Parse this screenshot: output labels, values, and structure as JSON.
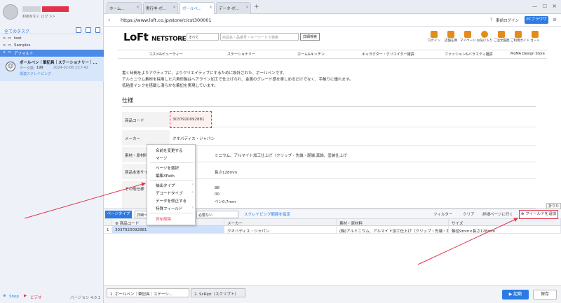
{
  "sidebar": {
    "user_sub": "利用を引く ログ >>",
    "all_tasks": "全てのタスク",
    "tree": [
      {
        "label": "test",
        "arrow": ">"
      },
      {
        "label": "Samples",
        "arrow": ">"
      },
      {
        "label": "デフォルト",
        "arrow": "∨"
      }
    ],
    "task": {
      "name": "ボールペン｜筆記具｜ステーショナリー｜...",
      "count_label": "データ数:",
      "count": "199",
      "date": "2024-02-08 13:7:42",
      "link": "関連スクレイピング"
    },
    "footer": {
      "shop": "Shop",
      "video": "ビデオ",
      "version": "バージョン 4.0.1"
    }
  },
  "browser": {
    "tabs": [
      {
        "label": "ホーム..."
      },
      {
        "label": "実行中-ボ..."
      },
      {
        "label": "ボールペ..."
      },
      {
        "label": "データ-ボ..."
      }
    ],
    "url": "https://www.loft.co.jp/store/c/cst300001",
    "login": "事前ログイン",
    "pc_browser": "PCブラウザ"
  },
  "site": {
    "logo_big": "LoFt",
    "logo_small": "NETSTORE",
    "select": "すべて",
    "search_placeholder": "商品名・品番号・キーワードで検索",
    "detail_search": "詳細検索",
    "header_icons": [
      {
        "label": "ログイン",
        "name": "login-icon"
      },
      {
        "label": "店舗在庫",
        "name": "store-icon"
      },
      {
        "label": "マイページ",
        "name": "mypage-icon"
      },
      {
        "label": "お気に入り",
        "name": "favorite-icon"
      },
      {
        "label": "ご注文履歴",
        "name": "order-history-icon"
      },
      {
        "label": "ご利用ガイド",
        "name": "guide-icon"
      },
      {
        "label": "カート",
        "name": "cart-icon"
      }
    ],
    "categories": [
      "コスメ&ビューティー",
      "ステーショナリー",
      "ホーム&キッチン",
      "キャラクター・クリエイター雑貨",
      "ファッション&バラエティ雑貨",
      "MoMA Design Store"
    ],
    "paragraph": [
      "書く時間をよりアクティブに、よりクリエイティブにするために設計された、ボールペンです。",
      "アルミニウム素材を採用した六角形軸はヘアライン加工で仕上げられ、金属のグレード感を楽しめるだけでなく、手触りに優れます。",
      "低粘度インクを搭載し滑らかな筆記を実現しています。"
    ],
    "spec_heading": "仕様",
    "spec_rows": [
      {
        "label": "商品コード",
        "value": "3037920092881"
      },
      {
        "label": "メーカー",
        "value": "クオバディス・ジャパン"
      },
      {
        "label": "素材・原材料",
        "value": "ミニウム、アルマイト加工仕上げ（クリップ・先端・尾端:真鍮、塗装仕上げ"
      },
      {
        "label": "商品本体サイズ",
        "value": "長さ128mm"
      },
      {
        "label": "その他仕様",
        "value": "88"
      },
      {
        "label": "",
        "value": "00"
      },
      {
        "label": "",
        "value": "ペン0.7mm"
      }
    ]
  },
  "context_menu": [
    "名前を変更する",
    "マージ",
    "ページを選択",
    "編集XPath",
    "抽出タイプ",
    "デコードタイプ",
    "データを修正する",
    "特殊フィールド",
    "列を削除"
  ],
  "toolbar": {
    "page_type": "ページタイプ",
    "dropdown": "詳細ページ",
    "not_needed": "必要ない",
    "scrape_range": "スクレイピング範囲を指定",
    "filter": "フィルター",
    "clear": "クリア",
    "goto_detail": "詳細ページに行く",
    "add_field": "フィールドを追加",
    "fold": "折りた"
  },
  "table": {
    "columns": [
      "商品コード",
      "メーカー",
      "素材・原材料",
      "サイズ"
    ],
    "rows": [
      {
        "index": "1",
        "code": "3037920092881",
        "maker": "クオバディス・ジャパン",
        "material": "(軸)アルミニウム、アルマイト加工仕上げ（クリップ・先端・尾...",
        "size": "軸径9mm×長さ128mm"
      }
    ]
  },
  "bottom": {
    "tabs": [
      "1. ボールペン｜筆記具｜ステーシ...",
      "2. ScRipt（スクリプト）"
    ],
    "start": "起動",
    "save": "保存"
  },
  "colors": {
    "accent": "#2c7be5",
    "highlight": "#e2334d",
    "brand_orange": "#e38b1c"
  }
}
